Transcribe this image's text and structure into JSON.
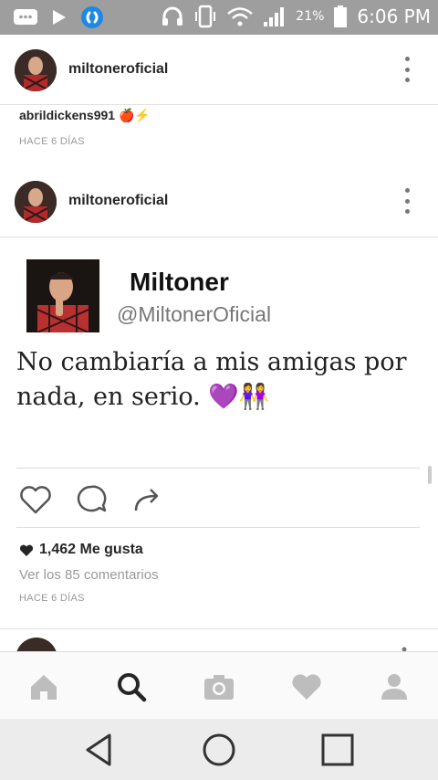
{
  "status_bar": {
    "battery_percent": "21%",
    "time": "6:06 PM"
  },
  "posts": [
    {
      "username": "miltoneroficial"
    },
    {
      "username": "miltoneroficial"
    }
  ],
  "prev_comment": {
    "username": "abrildickens991",
    "emoji": "🍎⚡",
    "timestamp": "HACE 6 DÍAS"
  },
  "tweet": {
    "name": "Miltoner",
    "handle": "@MiltonerOficial",
    "text": "No cambiaría a mis amigas por nada, en serio. 💜👭"
  },
  "post_meta": {
    "likes": "1,462 Me gusta",
    "view_comments": "Ver los 85 comentarios",
    "timestamp": "HACE 6 DÍAS"
  },
  "icons": {
    "like": "heart-outline-icon",
    "comment": "comment-icon",
    "share": "share-icon",
    "home": "home-icon",
    "search": "search-icon",
    "camera": "camera-icon",
    "activity": "heart-icon",
    "profile": "profile-icon"
  },
  "colors": {
    "status_bar": "#9e9e9e",
    "nav_active": "#262626",
    "nav_inactive": "#bdbdbd",
    "meta_grey": "#999999"
  }
}
